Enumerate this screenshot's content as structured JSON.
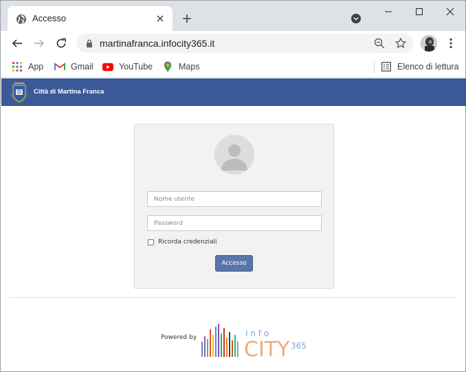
{
  "browser": {
    "tab": {
      "title": "Accesso",
      "favicon": "globe-icon"
    },
    "omnibox": {
      "url": "martinafranca.infocity365.it"
    },
    "bookmarks": [
      {
        "label": "App",
        "icon": "apps-grid-icon"
      },
      {
        "label": "Gmail",
        "icon": "gmail-icon"
      },
      {
        "label": "YouTube",
        "icon": "youtube-icon"
      },
      {
        "label": "Maps",
        "icon": "maps-pin-icon"
      }
    ],
    "reading_list": {
      "label": "Elenco di lettura",
      "icon": "reading-list-icon"
    }
  },
  "site": {
    "header": {
      "name": "Città di Martina Franca",
      "color": "#3b5998"
    }
  },
  "login": {
    "username_placeholder": "Nome utente",
    "password_placeholder": "Password",
    "remember_label": "Ricorda credenziali",
    "submit_label": "Accesso",
    "button_color": "#5a76a8"
  },
  "footer": {
    "powered_by": "Powered by",
    "logo_info": "I n f o",
    "logo_city": "CITY",
    "logo_365": "365"
  }
}
